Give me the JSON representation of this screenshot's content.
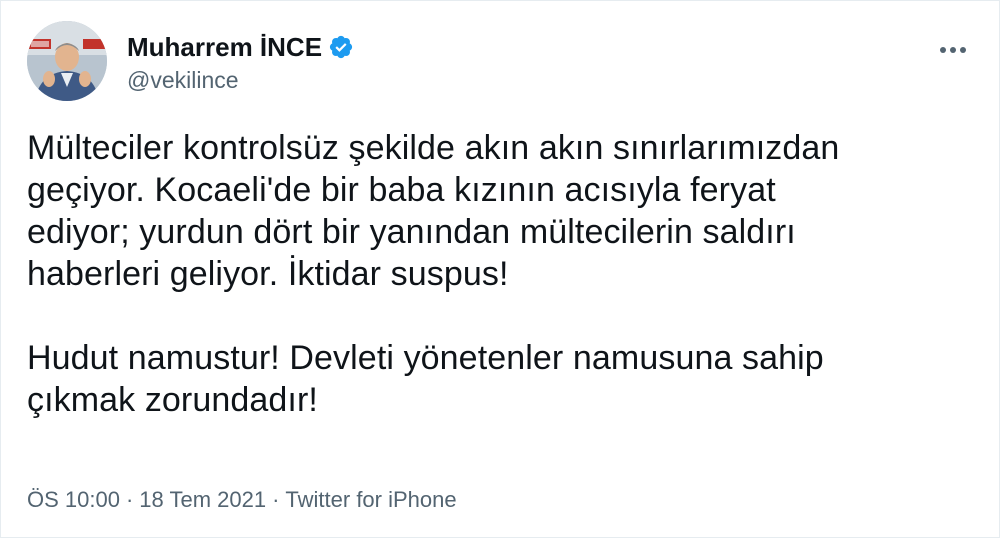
{
  "author": {
    "display_name": "Muharrem İNCE",
    "handle": "@vekilince",
    "verified": true,
    "verified_icon": "verified-badge-icon",
    "verified_color": "#1d9bf0"
  },
  "menu": {
    "icon": "more-horizontal-icon"
  },
  "tweet": {
    "lines_p1": [
      "Mülteciler kontrolsüz şekilde akın akın sınırlarımızdan",
      "geçiyor. Kocaeli'de bir baba kızının acısıyla feryat",
      "ediyor; yurdun dört bir yanından mültecilerin saldırı",
      "haberleri geliyor. İktidar suspus!"
    ],
    "lines_p2": [
      "Hudut namustur! Devleti yönetenler namusuna sahip",
      "çıkmak zorundadır!"
    ]
  },
  "meta": {
    "time": "ÖS 10:00",
    "separator": "·",
    "date": "18 Tem 2021",
    "source": "Twitter for iPhone"
  },
  "colors": {
    "text": "#0f1419",
    "secondary": "#536471",
    "accent": "#1d9bf0"
  }
}
